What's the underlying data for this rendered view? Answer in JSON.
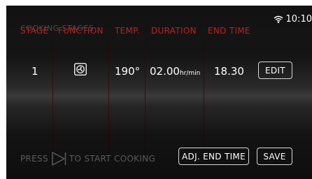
{
  "status": {
    "time": "10:10",
    "wifi_icon": "wifi-icon"
  },
  "title": "COOKING STAGES",
  "columns": {
    "stage": "STAGE",
    "function": "FUNCTION",
    "temp": "TEMP.",
    "duration": "DURATION",
    "end_time": "END TIME"
  },
  "row": {
    "stage": "1",
    "function_icon": "fan-icon",
    "temp": "190°",
    "duration": "02.00",
    "duration_unit": "hr/min",
    "end_time": "18.30"
  },
  "buttons": {
    "edit": "EDIT",
    "adj_end_time": "ADJ. END TIME",
    "save": "SAVE"
  },
  "footer": {
    "press": "PRESS",
    "to_start": "TO START COOKING"
  },
  "colors": {
    "header_red": "#c11f1f",
    "title_grey": "#4b4b4b",
    "footer_grey": "#5a5a5a"
  }
}
